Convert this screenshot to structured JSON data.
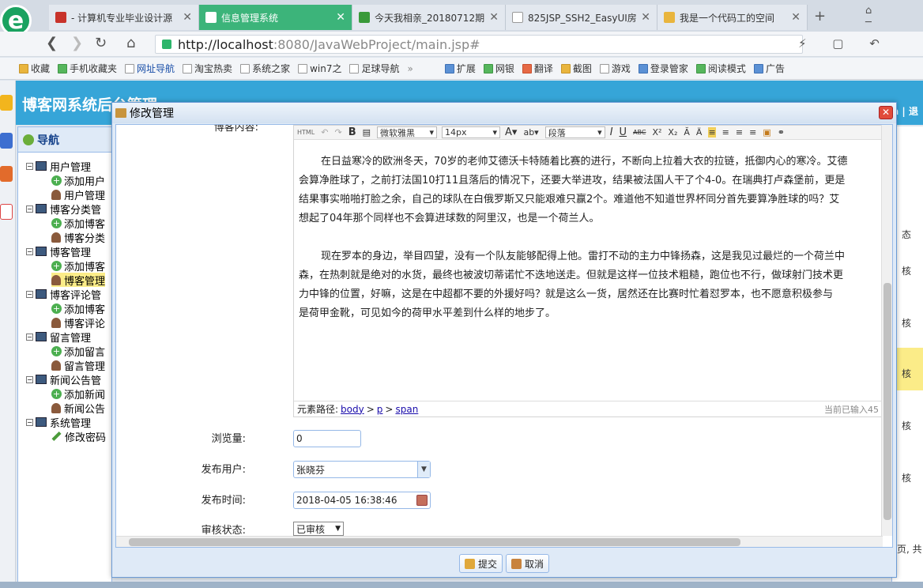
{
  "browser": {
    "tabs": [
      {
        "label": "- 计算机专业毕业设计源",
        "active": false
      },
      {
        "label": "信息管理系统",
        "active": true
      },
      {
        "label": "今天我相亲_20180712期",
        "active": false
      },
      {
        "label": "825JSP_SSH2_EasyUI房",
        "active": false
      },
      {
        "label": "我是一个代码工的空间",
        "active": false
      }
    ],
    "new_tab": "+",
    "address": {
      "host": "http://localhost",
      "path": ":8080/JavaWebProject/main.jsp#"
    },
    "bookmarks": [
      "收藏",
      "手机收藏夹",
      "网址导航",
      "淘宝热卖",
      "系统之家",
      "win7之",
      "足球导航"
    ],
    "bookmarks_more": "»",
    "tools": [
      "扩展",
      "网银",
      "翻译",
      "截图",
      "游戏",
      "登录管家",
      "阅读模式",
      "广告"
    ]
  },
  "app": {
    "title": "博客网系统后台管理",
    "nav_title": "导航",
    "tree": [
      {
        "label": "用户管理",
        "type": "group"
      },
      {
        "label": "添加用户",
        "type": "add"
      },
      {
        "label": "用户管理",
        "type": "user"
      },
      {
        "label": "博客分类管",
        "type": "group"
      },
      {
        "label": "添加博客",
        "type": "add"
      },
      {
        "label": "博客分类",
        "type": "user"
      },
      {
        "label": "博客管理",
        "type": "group"
      },
      {
        "label": "添加博客",
        "type": "add"
      },
      {
        "label": "博客管理",
        "type": "user",
        "selected": true
      },
      {
        "label": "博客评论管",
        "type": "group"
      },
      {
        "label": "添加博客",
        "type": "add"
      },
      {
        "label": "博客评论",
        "type": "user"
      },
      {
        "label": "留言管理",
        "type": "group"
      },
      {
        "label": "添加留言",
        "type": "add"
      },
      {
        "label": "留言管理",
        "type": "user"
      },
      {
        "label": "新闻公告管",
        "type": "group"
      },
      {
        "label": "添加新闻",
        "type": "add"
      },
      {
        "label": "新闻公告",
        "type": "user"
      },
      {
        "label": "系统管理",
        "type": "group"
      },
      {
        "label": "修改密码",
        "type": "pen"
      }
    ],
    "right_col": [
      "态",
      "核",
      "核",
      "核",
      "核",
      "核",
      "页, 共"
    ]
  },
  "modal": {
    "title": "修改管理",
    "close": "✕",
    "content_label": "博客内容:",
    "editor": {
      "toolbar": {
        "html": "HTML",
        "bold": "B",
        "font": "微软雅黑",
        "size": "14px",
        "paragraph": "段落",
        "italic": "I",
        "underline": "U",
        "strike": "ABC"
      },
      "paragraphs": [
        [
          "在日益寒冷的欧洲冬天，70岁的老帅艾德沃卡特随着比赛的进行，不断向上拉着大衣的拉链，抵御内心的寒冷。艾德",
          "会算净胜球了，之前打法国10打11且落后的情况下，还要大举进攻，结果被法国人干了个4-0。在瑞典打卢森堡前，更是",
          "结果事实啪啪打脸之余，自己的球队在白俄罗斯又只能艰难只赢2个。难道他不知道世界杯同分首先要算净胜球的吗？艾",
          "想起了04年那个同样也不会算进球数的阿里汉，也是一个荷兰人。"
        ],
        [
          "现在罗本的身边，举目四望，没有一个队友能够配得上他。雷打不动的主力中锋扬森，这是我见过最烂的一个荷兰中",
          "森，在热刺就是绝对的水货，最终也被波切蒂诺忙不迭地送走。但就是这样一位技术粗糙，跑位也不行，做球射门技术更",
          "力中锋的位置，好嘛，这是在中超都不要的外援好吗？就是这么一货，居然还在比赛时忙着怼罗本，也不愿意积极参与",
          "是荷甲金靴，可见如今的荷甲水平差到什么样的地步了。"
        ]
      ],
      "path_label": "元素路径:",
      "path": [
        "body",
        "p",
        "span"
      ],
      "path_sep": ">",
      "count": "当前已输入45"
    },
    "fields": {
      "views_label": "浏览量:",
      "views_value": "0",
      "user_label": "发布用户:",
      "user_value": "张晓芬",
      "time_label": "发布时间:",
      "time_value": "2018-04-05 16:38:46",
      "status_label": "审核状态:",
      "status_value": "已审核"
    },
    "buttons": {
      "submit": "提交",
      "cancel": "取消"
    }
  }
}
